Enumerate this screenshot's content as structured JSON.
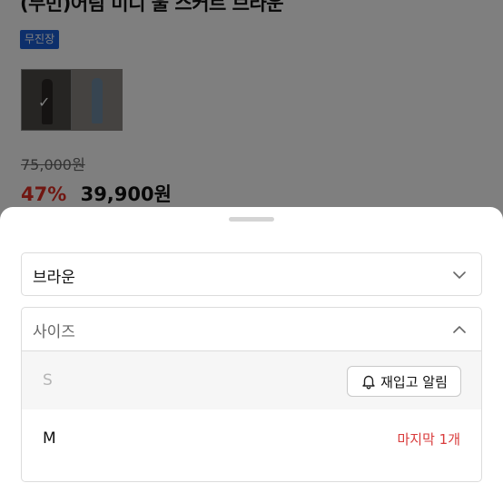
{
  "product": {
    "title": "(무빈)어림 미디 울 스커트 브라운",
    "badge": "무진장",
    "original_price": "75,000원",
    "discount": "47%",
    "sale_price": "39,900원"
  },
  "sheet": {
    "color_select": {
      "value": "브라운",
      "icon": "chevron-down-icon"
    },
    "size_select": {
      "placeholder": "사이즈",
      "icon": "chevron-up-icon",
      "options": [
        {
          "label": "S",
          "status": "soldout",
          "action_label": "재입고 알림",
          "action_icon": "bell-icon"
        },
        {
          "label": "M",
          "status": "available",
          "note": "마지막 1개"
        }
      ]
    }
  },
  "colors": {
    "badge_bg": "#1a5fd6",
    "discount": "#e02e24",
    "stock_note": "#d93c3c",
    "overlay": "rgba(0,0,0,0.5)"
  }
}
